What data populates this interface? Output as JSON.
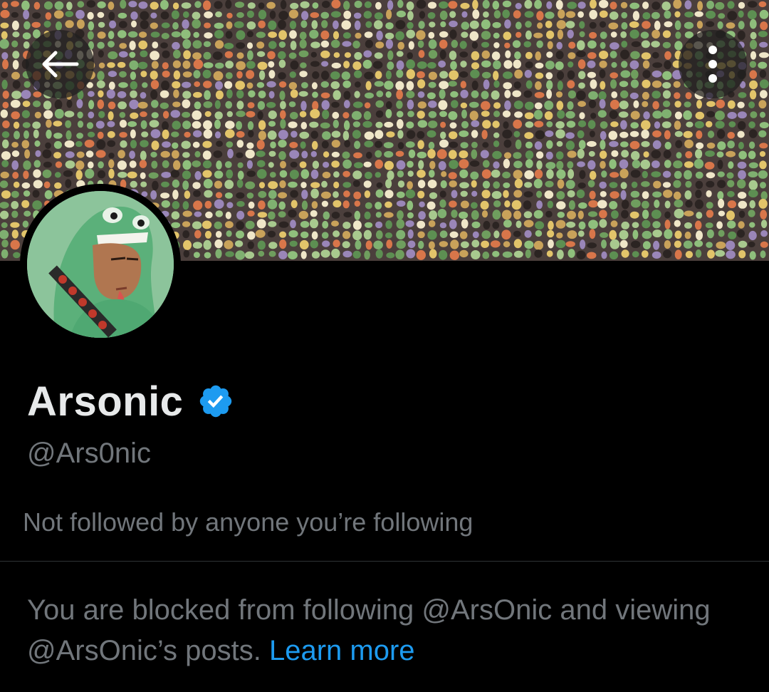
{
  "header": {
    "back_button": {
      "icon": "arrow-left-icon"
    },
    "more_button": {
      "icon": "more-vertical-icon"
    },
    "banner": {
      "description": ""
    }
  },
  "profile": {
    "display_name": "Arsonic",
    "verified": true,
    "handle": "@Ars0nic",
    "followers_context": "Not followed by anyone you’re following"
  },
  "blocked_notice": {
    "text": "You are blocked from following @ArsOnic and viewing @ArsOnic’s posts.",
    "link_label": "Learn more"
  },
  "colors": {
    "background": "#000000",
    "primary_text": "#e7e9ea",
    "secondary_text": "#71767b",
    "link": "#1d9bf0",
    "verified_badge": "#1d9bf0",
    "divider": "#2f3336"
  }
}
